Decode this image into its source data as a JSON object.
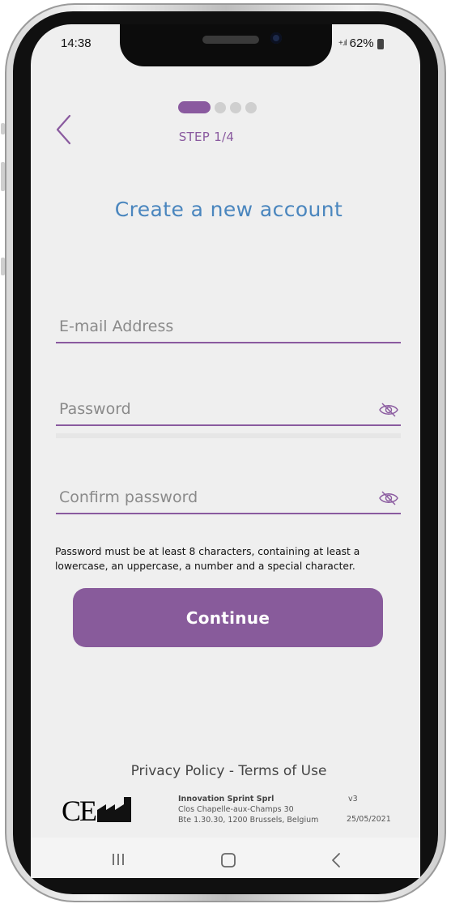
{
  "status_bar": {
    "time": "14:38",
    "signal": "+.ıl",
    "battery": "62%"
  },
  "header": {
    "back_icon": "chevron-left-icon",
    "step_label": "STEP 1/4",
    "steps_total": 4,
    "step_current": 1
  },
  "form": {
    "title": "Create a new account",
    "email": {
      "placeholder": "E-mail Address",
      "value": ""
    },
    "password": {
      "placeholder": "Password",
      "value": "",
      "icon": "eye-off-icon"
    },
    "confirm": {
      "placeholder": "Confirm password",
      "value": "",
      "icon": "eye-off-icon"
    },
    "hint": "Password must be at least 8 characters, containing at least a lowercase, an uppercase, a number and a special character.",
    "continue_label": "Continue"
  },
  "footer": {
    "privacy": "Privacy Policy",
    "separator": "-",
    "terms": "Terms of Use",
    "ce_mark": "CE",
    "company_name": "Innovation Sprint Sprl",
    "address_line1": "Clos Chapelle-aux-Champs 30",
    "address_line2": "Bte 1.30.30, 1200 Brussels, Belgium",
    "version": "v3",
    "date": "25/05/2021"
  },
  "nav": {
    "recents_icon": "recents-icon",
    "home_icon": "home-icon",
    "back_icon": "back-icon"
  },
  "colors": {
    "accent": "#885b9b",
    "title_blue": "#4a86be",
    "screen_bg": "#efefef"
  }
}
